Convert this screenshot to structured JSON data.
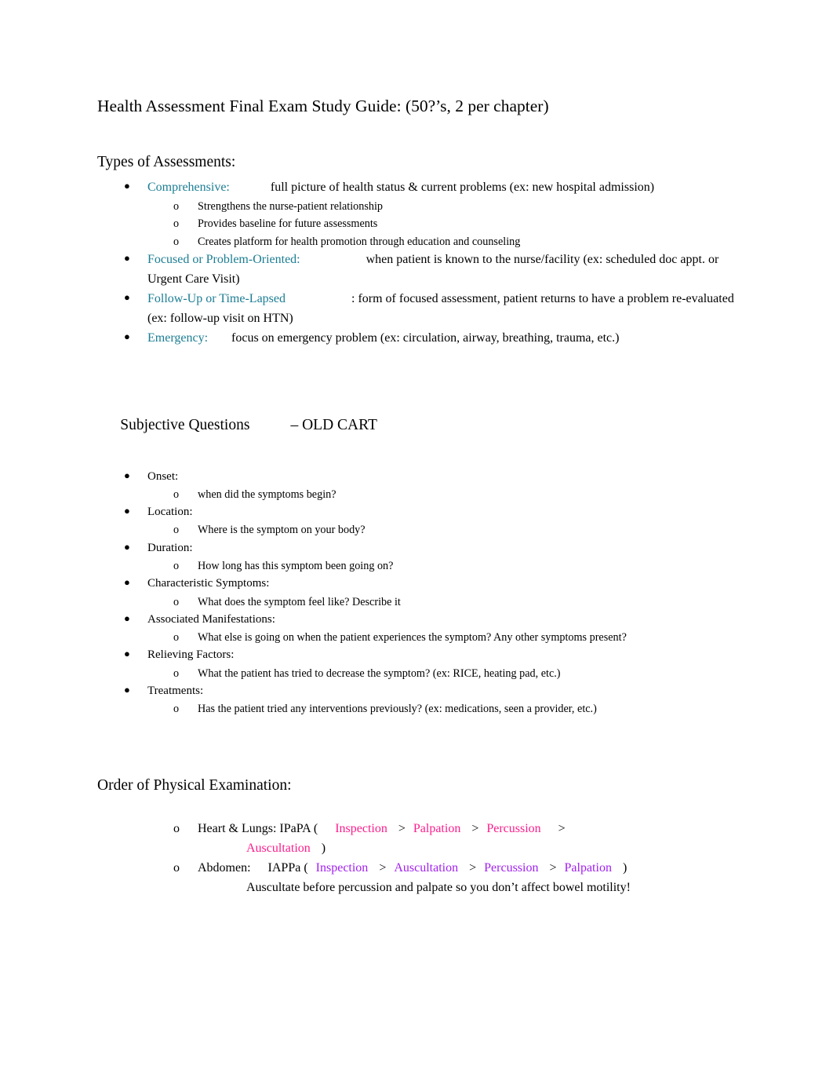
{
  "document": {
    "title": "Health Assessment Final Exam Study Guide: (50?’s, 2 per chapter)"
  },
  "sections": [
    {
      "heading": "Types of Assessments:",
      "items": [
        {
          "term": "Comprehensive:",
          "term_color": "#1B7D93",
          "definition": "full picture of health status & current problems (ex: new hospital admission)",
          "sub": [
            "Strengthens the nurse-patient relationship",
            "Provides baseline for future assessments",
            "Creates platform for health promotion through education and counseling"
          ]
        },
        {
          "term": "Focused or Problem-Oriented:",
          "term_color": "#1B7D93",
          "definition": "when patient is known to the nurse/facility (ex: scheduled doc appt. or Urgent Care Visit)",
          "sub": []
        },
        {
          "term": "Follow-Up or Time-Lapsed",
          "term_color": "#1B7D93",
          "definition": ": form of focused assessment, patient returns to have a problem re-evaluated (ex: follow-up visit on HTN)",
          "sub": []
        },
        {
          "term": "Emergency:",
          "term_color": "#1B7D93",
          "definition": "focus on emergency problem (ex: circulation, airway, breathing, trauma, etc.)",
          "sub": []
        }
      ]
    },
    {
      "heading_part1": "Subjective Questions",
      "heading_part2": "– OLD CART",
      "items": [
        {
          "term": "Onset:",
          "sub": [
            "when did the symptoms begin?"
          ]
        },
        {
          "term": "Location:",
          "sub": [
            "Where is the symptom on your body?"
          ]
        },
        {
          "term": "Duration:",
          "sub": [
            "How long has this symptom been going on?"
          ]
        },
        {
          "term": "Characteristic Symptoms:",
          "sub": [
            "What does the symptom feel like? Describe it"
          ]
        },
        {
          "term": "Associated Manifestations:",
          "sub": [
            "What else is going on when the patient experiences the symptom? Any other symptoms present?"
          ]
        },
        {
          "term": "Relieving Factors:",
          "sub": [
            "What the patient has tried to decrease the symptom? (ex: RICE, heating pad, etc.)"
          ]
        },
        {
          "term": "Treatments:",
          "sub": [
            "Has the patient tried any interventions previously? (ex: medications, seen a provider, etc.)"
          ]
        }
      ]
    },
    {
      "heading": "Order of Physical Examination:",
      "exam_rows": [
        {
          "label": "Heart & Lungs: IPaPA (",
          "steps": [
            "Inspection",
            "Palpation",
            "Percussion",
            "Auscultation"
          ],
          "separator": ">",
          "close_paren": ")",
          "color": "#FC1D8C",
          "note": ""
        },
        {
          "label": "Abdomen:",
          "acronym": "IAPPa (",
          "steps": [
            "Inspection",
            "Auscultation",
            "Percussion",
            "Palpation"
          ],
          "separator": ">",
          "close_paren": ")",
          "color": "#A020F0",
          "note": "Ausculate before percussion and palpate so you don’t affect bowel motility!",
          "note_actual": "Auscultate before percussion and palpate so you don’t affect bowel motility!"
        }
      ]
    }
  ],
  "glyphs": {
    "bullet": "●",
    "sub_marker": "o"
  }
}
